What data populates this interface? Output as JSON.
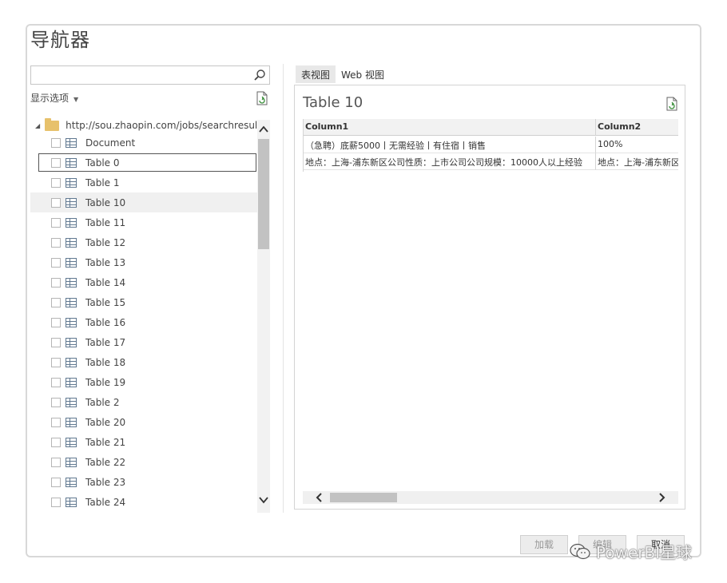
{
  "window": {
    "title": "导航器"
  },
  "search": {
    "placeholder": "",
    "value": ""
  },
  "left": {
    "display_options": "显示选项",
    "tree_root": "http://sou.zhaopin.com/jobs/searchresult.a...",
    "items": [
      {
        "label": "Document"
      },
      {
        "label": "Table 0"
      },
      {
        "label": "Table 1"
      },
      {
        "label": "Table 10"
      },
      {
        "label": "Table 11"
      },
      {
        "label": "Table 12"
      },
      {
        "label": "Table 13"
      },
      {
        "label": "Table 14"
      },
      {
        "label": "Table 15"
      },
      {
        "label": "Table 16"
      },
      {
        "label": "Table 17"
      },
      {
        "label": "Table 18"
      },
      {
        "label": "Table 19"
      },
      {
        "label": "Table 2"
      },
      {
        "label": "Table 20"
      },
      {
        "label": "Table 21"
      },
      {
        "label": "Table 22"
      },
      {
        "label": "Table 23"
      },
      {
        "label": "Table 24"
      }
    ]
  },
  "right": {
    "tabs": [
      {
        "label": "表视图"
      },
      {
        "label": "Web 视图"
      }
    ],
    "preview_title": "Table 10",
    "columns": [
      "Column1",
      "Column2"
    ],
    "rows": [
      [
        "（急聘）底薪5000丨无需经验丨有住宿丨销售",
        "100%"
      ],
      [
        "地点：上海-浦东新区公司性质：上市公司公司规模：10000人以上经验",
        "地点：上海-浦东新区"
      ]
    ]
  },
  "footer": {
    "load": "加载",
    "edit": "编辑",
    "cancel": "取消"
  },
  "watermark": "PowerBI星球"
}
